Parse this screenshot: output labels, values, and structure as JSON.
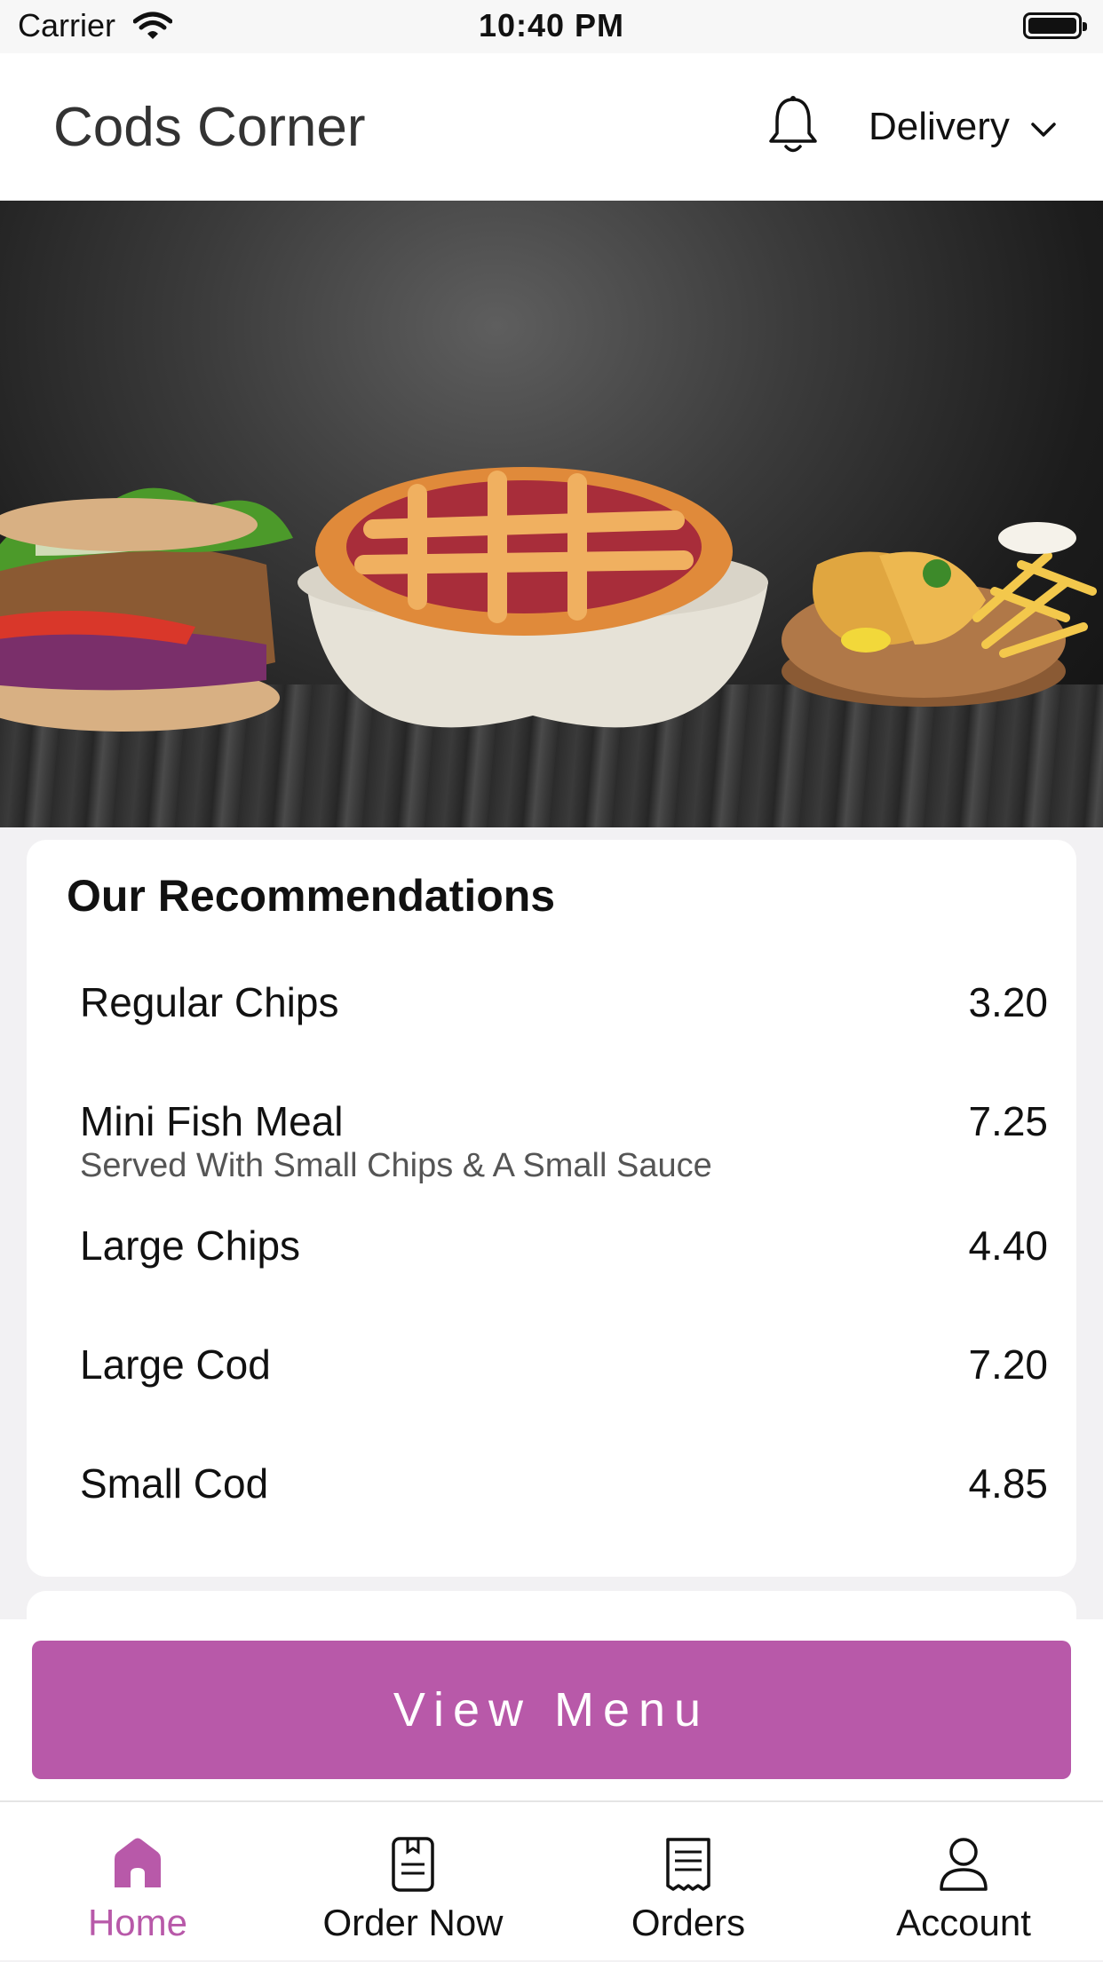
{
  "status_bar": {
    "carrier": "Carrier",
    "time": "10:40 PM"
  },
  "header": {
    "title": "Cods Corner",
    "delivery_label": "Delivery"
  },
  "recommendations": {
    "title": "Our Recommendations",
    "items": [
      {
        "name": "Regular Chips",
        "price": "3.20",
        "description": ""
      },
      {
        "name": "Mini Fish Meal",
        "price": "7.25",
        "description": "Served With Small Chips & A Small Sauce"
      },
      {
        "name": "Large Chips",
        "price": "4.40",
        "description": ""
      },
      {
        "name": "Large Cod",
        "price": "7.20",
        "description": ""
      },
      {
        "name": "Small Cod",
        "price": "4.85",
        "description": ""
      }
    ]
  },
  "cta": {
    "label": "View Menu"
  },
  "tabs": [
    {
      "label": "Home",
      "icon": "home-icon",
      "active": true
    },
    {
      "label": "Order Now",
      "icon": "order-now-icon",
      "active": false
    },
    {
      "label": "Orders",
      "icon": "receipt-icon",
      "active": false
    },
    {
      "label": "Account",
      "icon": "account-icon",
      "active": false
    }
  ],
  "colors": {
    "accent": "#b859a9",
    "background": "#f2f1f3",
    "card": "#ffffff"
  }
}
